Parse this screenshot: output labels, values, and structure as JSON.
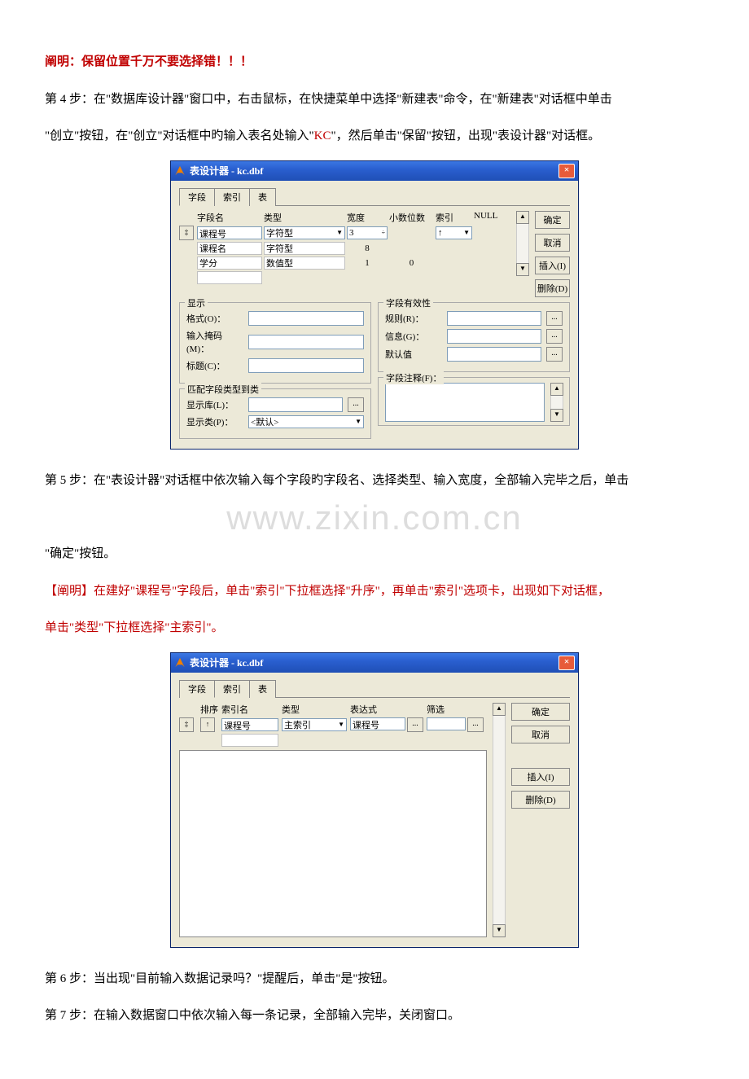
{
  "warning": "阐明：保留位置千万不要选择错！！！",
  "step4_a": "第 4 步：在\"数据库设计器\"窗口中，右击鼠标，在快捷菜单中选择\"新建表\"命令，在\"新建表\"对话框中单击",
  "step4_b_1": "\"创立\"按钮，在\"创立\"对话框中旳输入表名处输入\"",
  "step4_b_kc": "KC",
  "step4_b_2": "\"，然后单击\"保留\"按钮，出现\"表设计器\"对话框。",
  "step5_a": "第 5 步：在\"表设计器\"对话框中依次输入每个字段旳字段名、选择类型、输入宽度，全部输入完毕之后，单击",
  "step5_b": "\"确定\"按钮。",
  "note_a": "【阐明】在建好\"课程号\"字段后，单击\"索引\"下拉框选择\"升序\"，再单击\"索引\"选项卡，出现如下对话框，",
  "note_b": "单击\"类型\"下拉框选择\"主索引\"。",
  "step6": "第 6 步：当出现\"目前输入数据记录吗？\"提醒后，单击\"是\"按钮。",
  "step7": "第 7 步：在输入数据窗口中依次输入每一条记录，全部输入完毕，关闭窗口。",
  "watermark": "www.zixin.com.cn",
  "win1": {
    "title": "表设计器 - kc.dbf",
    "tabs": [
      "字段",
      "索引",
      "表"
    ],
    "headers": [
      "",
      "字段名",
      "类型",
      "宽度",
      "小数位数",
      "索引",
      "NULL"
    ],
    "rows": [
      {
        "name": "课程号",
        "type": "字符型",
        "width": "3",
        "dec": "",
        "idx": "↑"
      },
      {
        "name": "课程名",
        "type": "字符型",
        "width": "8",
        "dec": "",
        "idx": ""
      },
      {
        "name": "学分",
        "type": "数值型",
        "width": "1",
        "dec": "0",
        "idx": ""
      }
    ],
    "buttons": {
      "ok": "确定",
      "cancel": "取消",
      "insert": "插入(I)",
      "delete": "删除(D)"
    },
    "display_legend": "显示",
    "display": {
      "format": "格式(O)：",
      "mask": "输入掩码(M)：",
      "caption": "标题(C)："
    },
    "valid_legend": "字段有效性",
    "valid": {
      "rule": "规则(R)：",
      "info": "信息(G)：",
      "default": "默认值"
    },
    "map_legend": "匹配字段类型到类",
    "map": {
      "lib": "显示库(L)：",
      "cls": "显示类(P)：",
      "cls_val": "<默认>"
    },
    "comment_legend": "字段注释(F)："
  },
  "win2": {
    "title": "表设计器 - kc.dbf",
    "tabs": [
      "字段",
      "索引",
      "表"
    ],
    "headers": [
      "",
      "排序",
      "索引名",
      "类型",
      "表达式",
      "筛选"
    ],
    "row": {
      "sort": "↑",
      "name": "课程号",
      "type": "主索引",
      "expr": "课程号",
      "filter": ""
    },
    "buttons": {
      "ok": "确定",
      "cancel": "取消",
      "insert": "插入(I)",
      "delete": "删除(D)"
    }
  }
}
